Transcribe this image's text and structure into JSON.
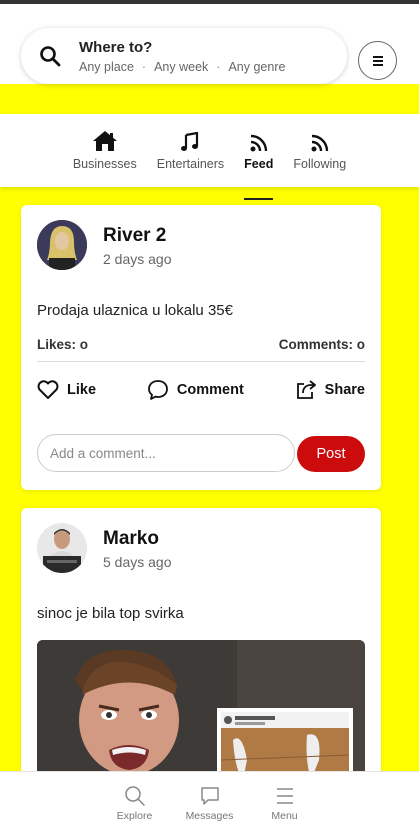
{
  "search": {
    "title": "Where to?",
    "place": "Any place",
    "week": "Any week",
    "genre": "Any genre",
    "separator": "·"
  },
  "tabs": [
    {
      "label": "Businesses",
      "icon": "home-icon"
    },
    {
      "label": "Entertainers",
      "icon": "music-note-icon"
    },
    {
      "label": "Feed",
      "icon": "rss-feed-icon",
      "active": true
    },
    {
      "label": "Following",
      "icon": "rss-feed-icon"
    }
  ],
  "posts": [
    {
      "author": "River 2",
      "time": "2 days ago",
      "text": "Prodaja ulaznica u lokalu 35€",
      "likes_label": "Likes: o",
      "comments_label": "Comments: o",
      "like_label": "Like",
      "comment_label": "Comment",
      "share_label": "Share",
      "comment_placeholder": "Add a comment...",
      "post_label": "Post"
    },
    {
      "author": "Marko",
      "time": "5 days ago",
      "text": "sinoc je bila top svirka",
      "image_overlay_user": "daaminator24"
    }
  ],
  "bottom_nav": [
    {
      "label": "Explore",
      "icon": "search-icon"
    },
    {
      "label": "Messages",
      "icon": "chat-bubble-icon"
    },
    {
      "label": "Menu",
      "icon": "hamburger-icon"
    }
  ],
  "colors": {
    "background": "#ffff00",
    "accent": "#cc0c0c"
  }
}
